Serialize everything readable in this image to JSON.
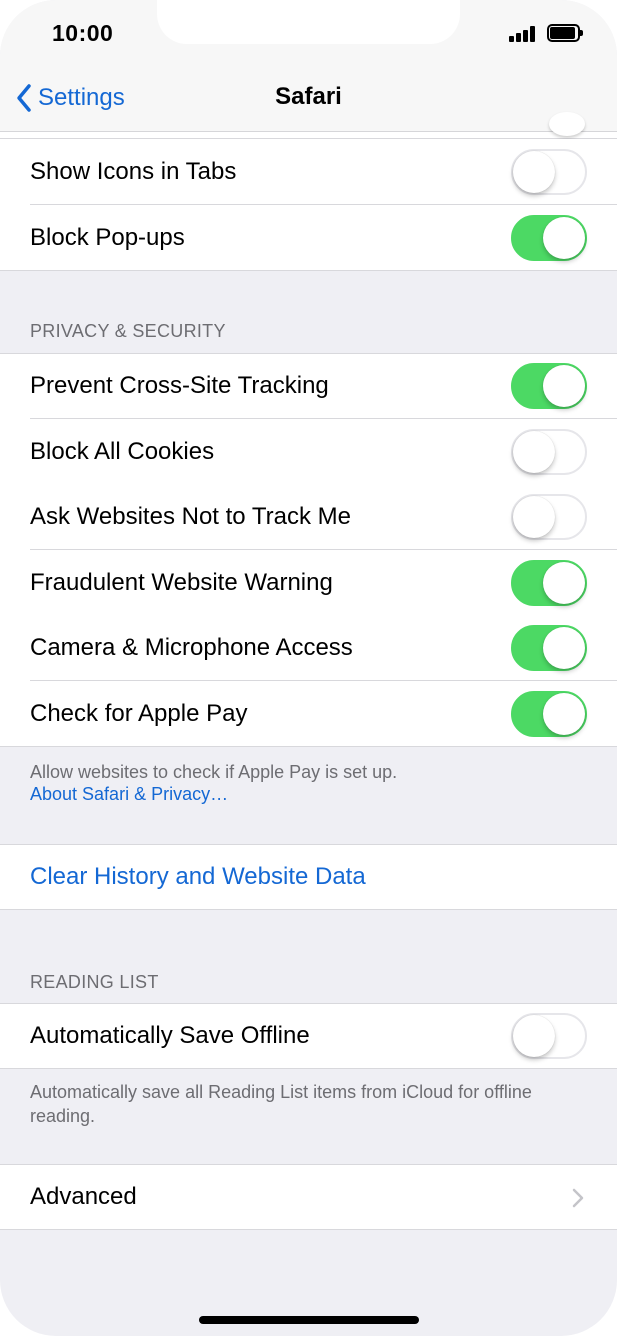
{
  "status_bar": {
    "time": "10:00"
  },
  "nav": {
    "back_label": "Settings",
    "title": "Safari"
  },
  "general": {
    "rows": [
      {
        "label": "Show Icons in Tabs",
        "on": false
      },
      {
        "label": "Block Pop-ups",
        "on": true
      }
    ]
  },
  "privacy": {
    "header": "PRIVACY & SECURITY",
    "rows": [
      {
        "label": "Prevent Cross-Site Tracking",
        "on": true
      },
      {
        "label": "Block All Cookies",
        "on": false
      },
      {
        "label": "Ask Websites Not to Track Me",
        "on": false
      },
      {
        "label": "Fraudulent Website Warning",
        "on": true
      },
      {
        "label": "Camera & Microphone Access",
        "on": true
      },
      {
        "label": "Check for Apple Pay",
        "on": true
      }
    ],
    "footer": "Allow websites to check if Apple Pay is set up.",
    "footer_link": "About Safari & Privacy…"
  },
  "clear_history": {
    "label": "Clear History and Website Data"
  },
  "reading_list": {
    "header": "READING LIST",
    "rows": [
      {
        "label": "Automatically Save Offline",
        "on": false
      }
    ],
    "footer": "Automatically save all Reading List items from iCloud for offline reading."
  },
  "advanced": {
    "label": "Advanced"
  },
  "colors": {
    "accent": "#1468d4",
    "toggle_on": "#4cd964",
    "background": "#efeff4"
  },
  "icons": {
    "back": "chevron-left-icon",
    "disclosure": "chevron-right-icon"
  }
}
